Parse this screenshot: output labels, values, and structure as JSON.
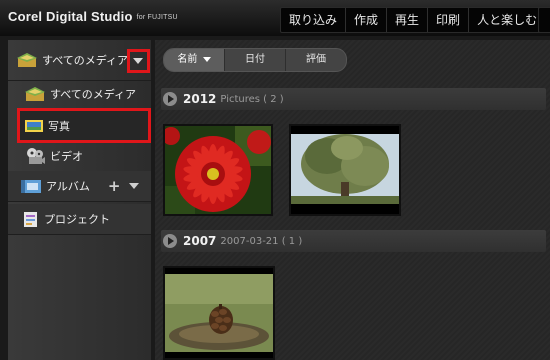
{
  "app": {
    "brand": "Corel Digital Studio",
    "brand_sub": "for FUJITSU",
    "menu": [
      "取り込み",
      "作成",
      "再生",
      "印刷",
      "人と楽しむ"
    ]
  },
  "sidebar": {
    "header_label": "すべてのメディア",
    "items": [
      {
        "label": "すべてのメディア",
        "icon": "media-stack-icon"
      },
      {
        "label": "写真",
        "icon": "photo-icon"
      },
      {
        "label": "ビデオ",
        "icon": "film-reel-icon"
      }
    ],
    "album_label": "アルバム",
    "project_label": "プロジェクト"
  },
  "sort": {
    "options": [
      "名前",
      "日付",
      "評価"
    ],
    "active": "名前"
  },
  "groups": [
    {
      "year": "2012",
      "subtitle": "Pictures ( 2 )"
    },
    {
      "year": "2007",
      "subtitle": "2007-03-21 ( 1 )"
    }
  ],
  "thumbnails": [
    {
      "name": "red-dahlia-photo",
      "group": "2012"
    },
    {
      "name": "tree-photo",
      "group": "2012"
    },
    {
      "name": "pine-cone-photo",
      "group": "2007"
    }
  ],
  "colors": {
    "highlight": "#e0161a",
    "background": "#1a1a1a"
  }
}
